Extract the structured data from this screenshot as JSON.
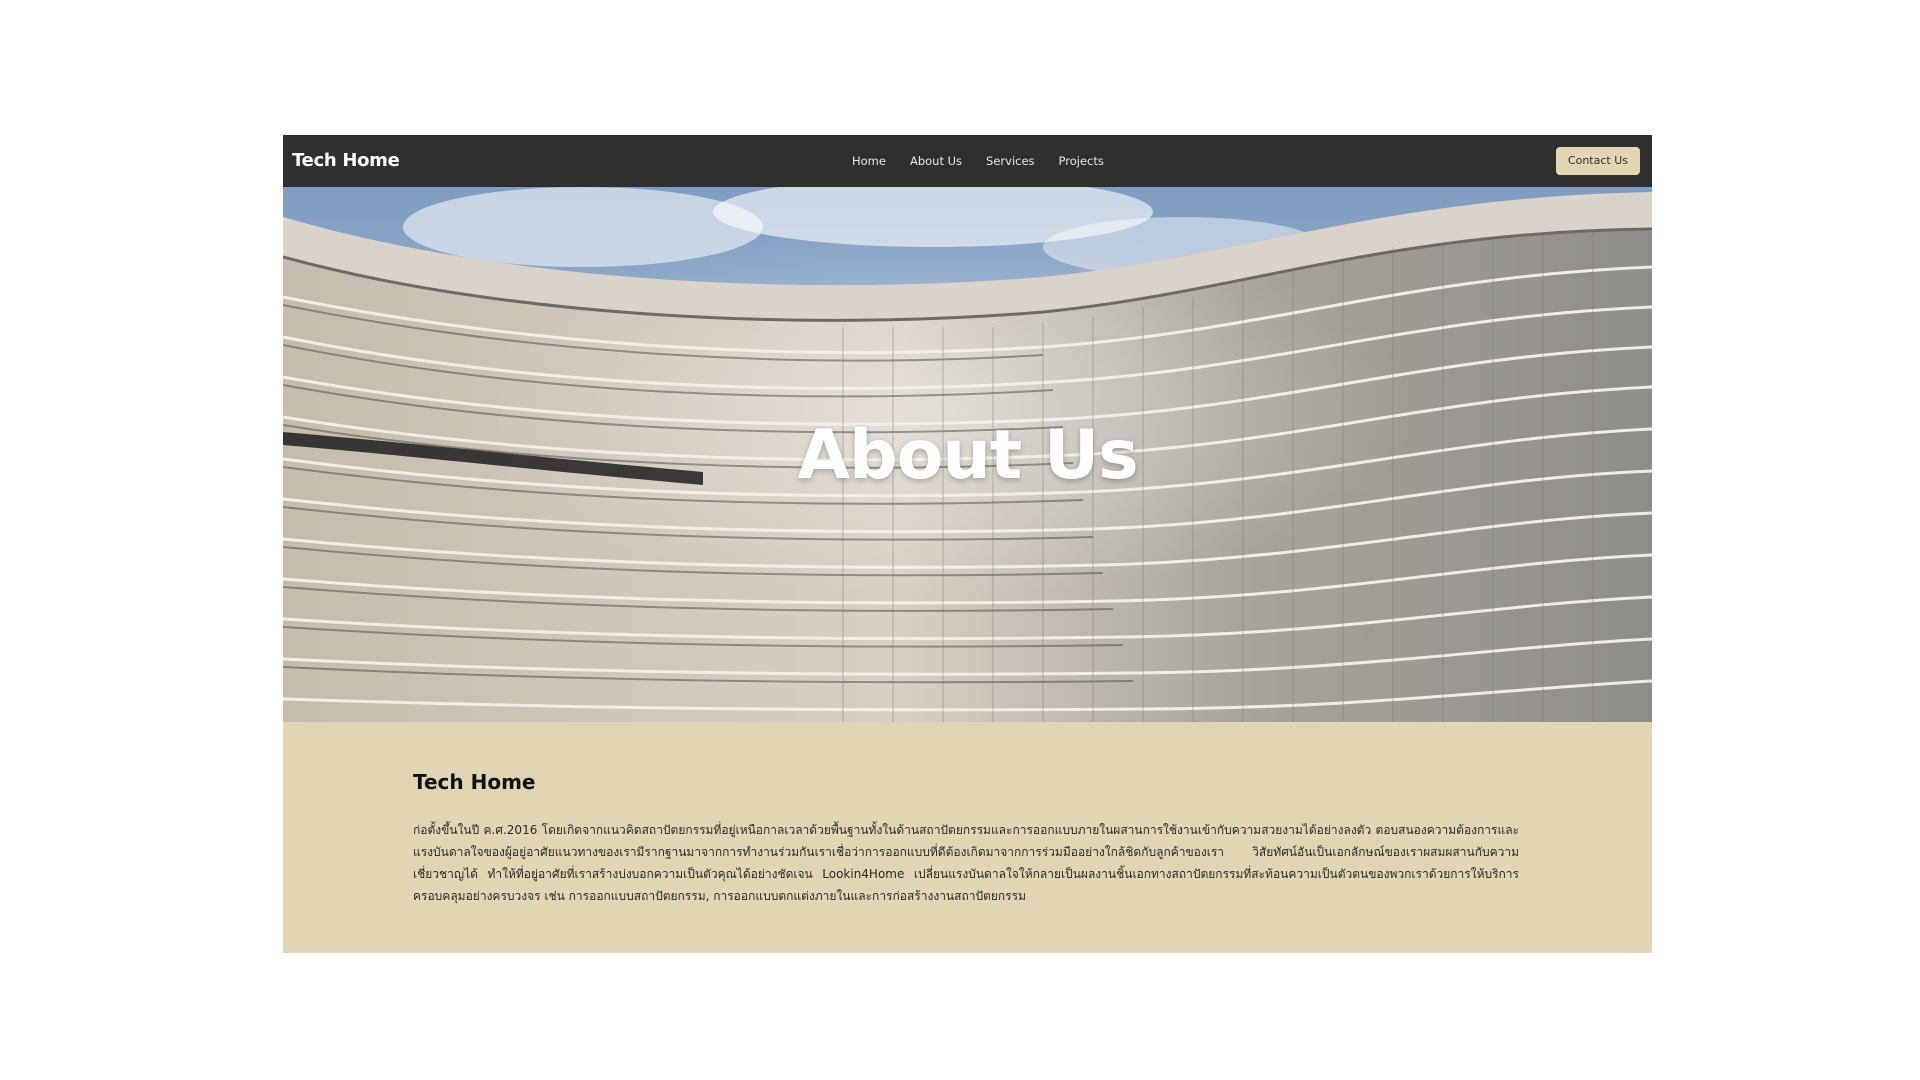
{
  "navbar": {
    "brand": "Tech Home",
    "links": [
      "Home",
      "About Us",
      "Services",
      "Projects"
    ],
    "contact_label": "Contact Us"
  },
  "hero": {
    "title": "About Us"
  },
  "about": {
    "title": "Tech Home",
    "body": "ก่อตั้งขึ้นในปี ค.ศ.2016 โดยเกิดจากแนวคิดสถาปัตยกรรมที่อยู่เหนือกาลเวลาด้วยพื้นฐานทั้งในด้านสถาปัตยกรรมและการออกแบบภายในผสานการใช้งานเข้ากับความสวยงามได้อย่างลงตัว ตอบสนองความต้องการและแรงบันดาลใจของผู้อยู่อาศัยแนวทางของเรามีรากฐานมาจากการทำงานร่วมกันเราเชื่อว่าการออกแบบที่ดีต้องเกิดมาจากการร่วมมืออย่างใกล้ชิดกับลูกค้าของเรา วิสัยทัศน์อันเป็นเอกลักษณ์ของเราผสมผสานกับความเชี่ยวชาญได้ ทำให้ที่อยู่อาศัยที่เราสร้างบ่งบอกความเป็นตัวคุณได้อย่างชัดเจน Lookin4Home เปลี่ยนแรงบันดาลใจให้กลายเป็นผลงานชิ้นเอกทางสถาปัตยกรรมที่สะท้อนความเป็นตัวตนของพวกเราด้วยการให้บริการครอบคลุมอย่างครบวงจร เช่น การออกแบบสถาปัตยกรรม, การออกแบบตกแต่งภายในและการก่อสร้างงานสถาปัตยกรรม"
  },
  "colors": {
    "navbar_bg": "#2f2f2d",
    "accent_beige": "#e2d5b4",
    "text_dark": "#111111"
  }
}
